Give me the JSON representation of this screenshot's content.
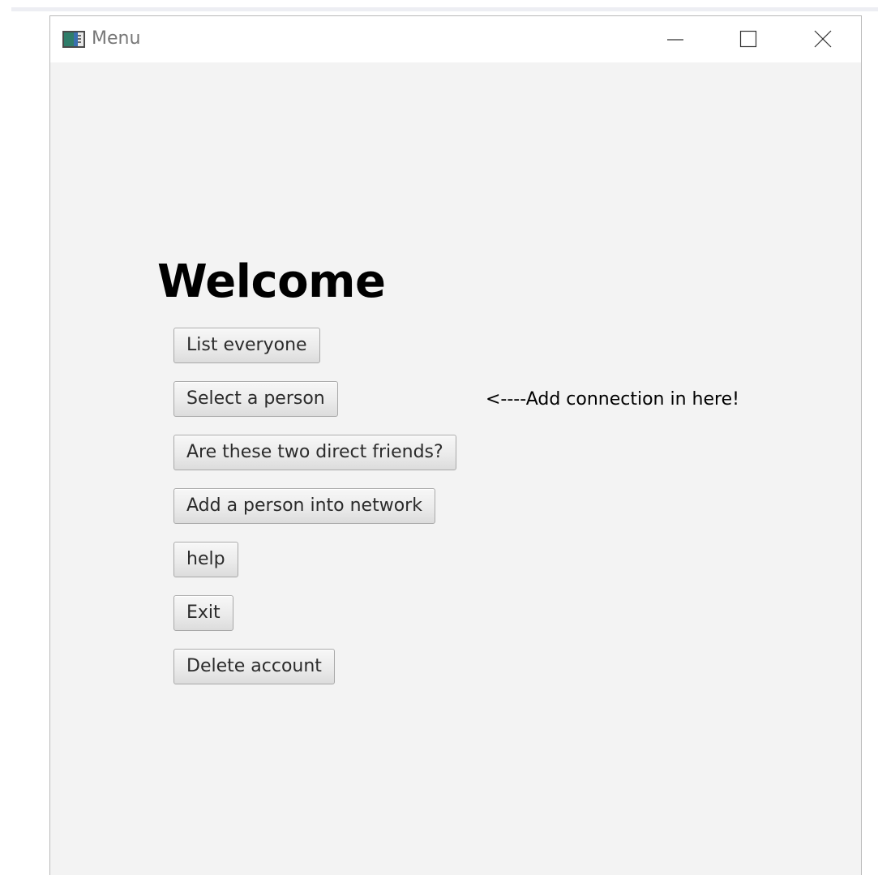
{
  "window": {
    "title": "Menu",
    "icon": "app-window-icon",
    "controls": [
      "minimize-icon",
      "maximize-icon",
      "close-icon"
    ]
  },
  "main": {
    "heading": "Welcome",
    "note": "<----Add connection in here!",
    "buttons": [
      {
        "label": "List everyone"
      },
      {
        "label": "Select a person"
      },
      {
        "label": "Are these two direct friends?"
      },
      {
        "label": "Add a person into network"
      },
      {
        "label": "help"
      },
      {
        "label": "Exit"
      },
      {
        "label": "Delete account"
      }
    ]
  }
}
